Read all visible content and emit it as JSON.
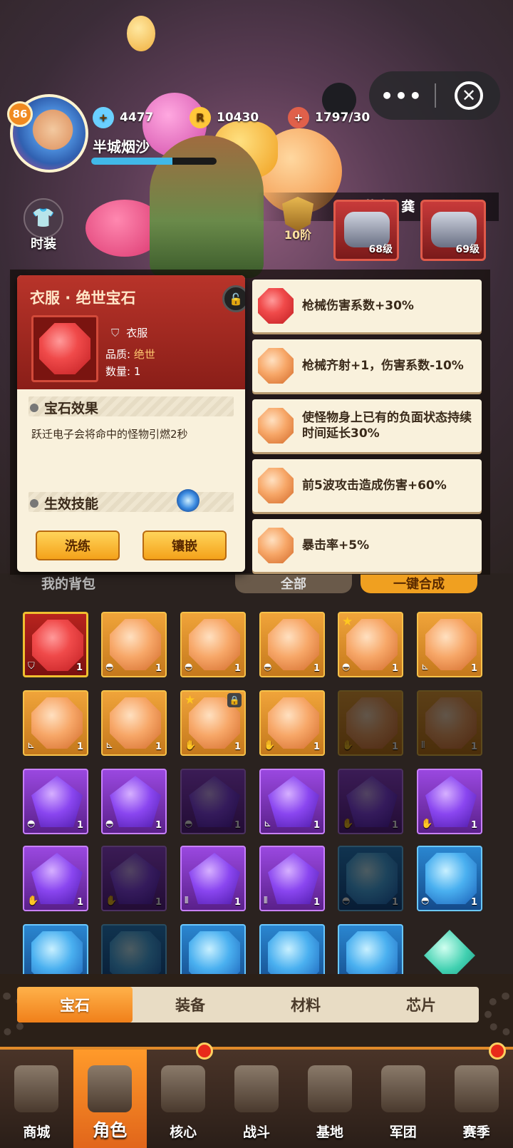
{
  "header": {
    "level": "86",
    "username": "半城烟沙",
    "diamonds": "4477",
    "coins": "10430",
    "stamina": "1797/30",
    "exp_fraction": 0.65
  },
  "mini_program": {
    "more_label": "•••",
    "close_label": "✕"
  },
  "scene": {
    "fashion_label": "时装",
    "congrats_text": "恭喜! 龚",
    "rank_label": "10阶",
    "mech_levels": [
      "68级",
      "69级"
    ]
  },
  "popup": {
    "title": "衣服 · 绝世宝石",
    "slot_name": "衣服",
    "quality_label": "品质:",
    "quality_value": "绝世",
    "count_label": "数量:",
    "count_value": "1",
    "effect_title": "宝石效果",
    "effect_text": "跃迁电子会将命中的怪物引燃2秒",
    "skill_title": "生效技能",
    "wash_button": "洗练",
    "inlay_button": "镶嵌"
  },
  "attributes": [
    {
      "color": "red",
      "text": "枪械伤害系数+30%"
    },
    {
      "color": "orange",
      "text": "枪械齐射+1，伤害系数-10%"
    },
    {
      "color": "orange",
      "text": "使怪物身上已有的负面状态持续时间延长30%"
    },
    {
      "color": "orange",
      "text": "前5波攻击造成伤害+60%"
    },
    {
      "color": "orange",
      "text": "暴击率+5%"
    }
  ],
  "behind": {
    "my_bag": "我的背包",
    "filter_all": "全部",
    "one_click_merge": "一键合成"
  },
  "inventory": [
    {
      "gem": "red",
      "slot": "coat",
      "qty": "1",
      "dark": false
    },
    {
      "gem": "orange",
      "slot": "helmet",
      "qty": "1",
      "dark": false
    },
    {
      "gem": "orange",
      "slot": "helmet",
      "qty": "1",
      "dark": false
    },
    {
      "gem": "orange",
      "slot": "helmet",
      "qty": "1",
      "dark": false
    },
    {
      "gem": "orange",
      "slot": "helmet",
      "qty": "1",
      "dark": false,
      "star": true
    },
    {
      "gem": "orange",
      "slot": "boots",
      "qty": "1",
      "dark": false
    },
    {
      "gem": "orange",
      "slot": "boots",
      "qty": "1",
      "dark": false
    },
    {
      "gem": "orange",
      "slot": "boots",
      "qty": "1",
      "dark": false
    },
    {
      "gem": "orange",
      "slot": "glove",
      "qty": "1",
      "dark": false,
      "star": true,
      "locked": true
    },
    {
      "gem": "orange",
      "slot": "glove",
      "qty": "1",
      "dark": false
    },
    {
      "gem": "orange",
      "slot": "glove",
      "qty": "1",
      "dark": true
    },
    {
      "gem": "orange",
      "slot": "pants",
      "qty": "1",
      "dark": true
    },
    {
      "gem": "purple",
      "slot": "helmet",
      "qty": "1",
      "dark": false
    },
    {
      "gem": "purple",
      "slot": "helmet",
      "qty": "1",
      "dark": false
    },
    {
      "gem": "purple",
      "slot": "helmet",
      "qty": "1",
      "dark": true
    },
    {
      "gem": "purple",
      "slot": "boots",
      "qty": "1",
      "dark": false
    },
    {
      "gem": "purple",
      "slot": "glove",
      "qty": "1",
      "dark": true
    },
    {
      "gem": "purple",
      "slot": "glove",
      "qty": "1",
      "dark": false
    },
    {
      "gem": "purple",
      "slot": "glove",
      "qty": "1",
      "dark": false
    },
    {
      "gem": "purple",
      "slot": "glove",
      "qty": "1",
      "dark": true
    },
    {
      "gem": "purple",
      "slot": "pants",
      "qty": "1",
      "dark": false
    },
    {
      "gem": "purple",
      "slot": "pants",
      "qty": "1",
      "dark": false
    },
    {
      "gem": "blue",
      "slot": "helmet",
      "qty": "1",
      "dark": true
    },
    {
      "gem": "blue",
      "slot": "helmet",
      "qty": "1",
      "dark": false
    },
    {
      "gem": "blue",
      "slot": "",
      "qty": "",
      "dark": false
    },
    {
      "gem": "blue",
      "slot": "",
      "qty": "",
      "dark": true
    },
    {
      "gem": "blue",
      "slot": "",
      "qty": "",
      "dark": false
    },
    {
      "gem": "blue",
      "slot": "",
      "qty": "",
      "dark": false
    },
    {
      "gem": "blue",
      "slot": "",
      "qty": "",
      "dark": false
    },
    {
      "gem": "teal",
      "slot": "",
      "qty": "",
      "dark": false
    }
  ],
  "slot_icons": {
    "coat": "⛉",
    "helmet": "◓",
    "boots": "⊾",
    "glove": "✋",
    "pants": "⫴"
  },
  "tabs": [
    {
      "label": "宝石",
      "active": true
    },
    {
      "label": "装备",
      "active": false
    },
    {
      "label": "材料",
      "active": false
    },
    {
      "label": "芯片",
      "active": false
    }
  ],
  "nav": [
    {
      "label": "商城",
      "active": false,
      "badge": false
    },
    {
      "label": "角色",
      "active": true,
      "badge": false
    },
    {
      "label": "核心",
      "active": false,
      "badge": true
    },
    {
      "label": "战斗",
      "active": false,
      "badge": false
    },
    {
      "label": "基地",
      "active": false,
      "badge": false
    },
    {
      "label": "军团",
      "active": false,
      "badge": false
    },
    {
      "label": "赛季",
      "active": false,
      "badge": true
    }
  ]
}
